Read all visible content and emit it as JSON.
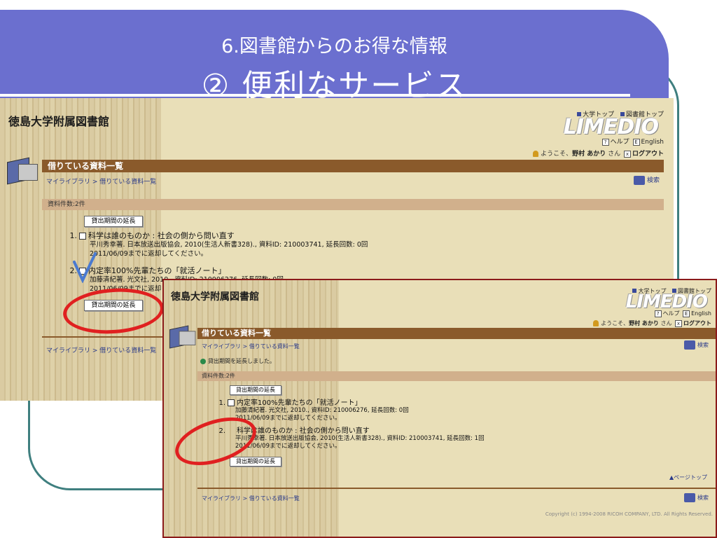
{
  "slide": {
    "subtitle": "6.図書館からのお得な情報",
    "title": "② 便利なサービス",
    "colors": {
      "banner": "#6b6fcf",
      "frame": "#3f7f7f",
      "annotation": "#e02020",
      "check": "#4a7ad0"
    }
  },
  "library": {
    "name": "徳島大学附属図書館",
    "univ_top": "大学トップ",
    "lib_top": "図書館トップ",
    "logo": "LIMEDIO",
    "help_icon": "?",
    "help": "ヘルプ",
    "english_icon": "E",
    "english": "English",
    "welcome": "ようこそ、",
    "user": "野村 あかり",
    "san": " さん",
    "logout_icon": "x",
    "logout": "ログアウト",
    "page_title": "借りている資料一覧",
    "breadcrumb": "マイライブラリ > 借りている資料一覧",
    "search": "検索",
    "count": "資料件数:2件",
    "extend_button": "貸出期間の延長",
    "pagetop": "▲ページトップ",
    "copyright": "Copyright (c) 1994-2008 RICOH COMPANY, LTD. All Rights Reserved."
  },
  "before": {
    "items": [
      {
        "num": "1.",
        "title": "科学は誰のものか : 社会の側から問い直す",
        "detail": "平川秀幸著. 日本放送出版協会, 2010(生活人新書328)., 資料ID: 210003741, 延長回数: 0回",
        "due": "2011/06/09までに返却してください。"
      },
      {
        "num": "2.",
        "title": "内定率100%先輩たちの「就活ノート」",
        "detail": "加藤清紀著. 光文社, 2010., 資料ID: 210006276, 延長回数: 0回",
        "due": "2011/06/09までに返却してください。"
      }
    ]
  },
  "after": {
    "message": "貸出期間を延長しました。",
    "items": [
      {
        "num": "1.",
        "title": "内定率100%先輩たちの「就活ノート」",
        "detail": "加藤清紀著. 光文社, 2010., 資料ID: 210006276, 延長回数: 0回",
        "due": "2011/06/09までに返却してください。"
      },
      {
        "num": "2.",
        "title": "科学は誰のものか : 社会の側から問い直す",
        "detail": "平川秀幸著. 日本放送出版協会, 2010(生活人新書328)., 資料ID: 210003741, 延長回数: 1回",
        "due": "2011/06/09までに返却してください。"
      }
    ]
  }
}
